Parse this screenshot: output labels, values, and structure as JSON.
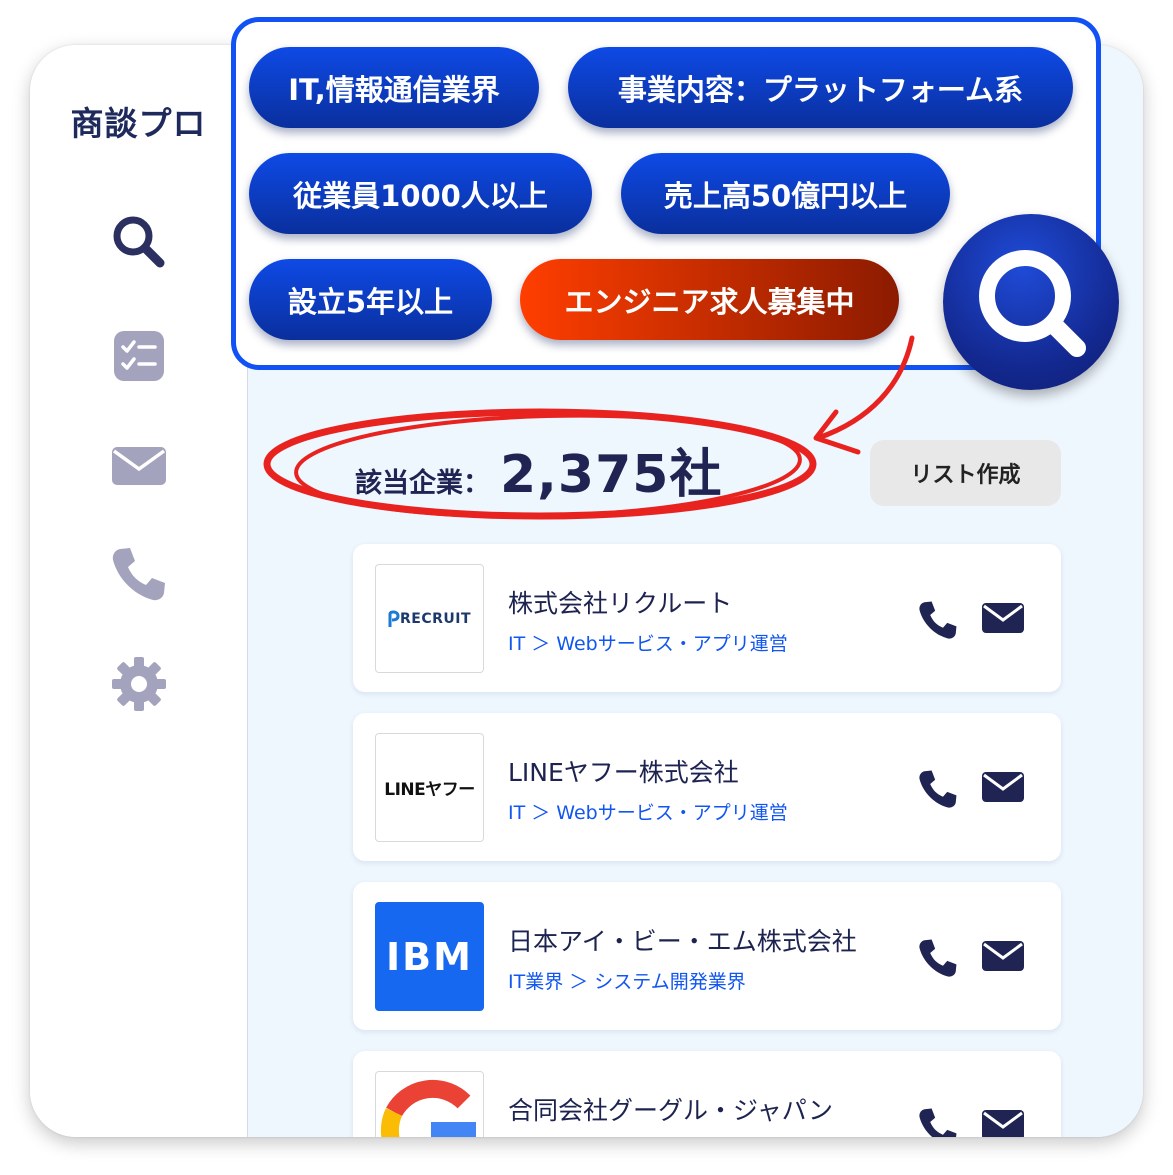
{
  "app": {
    "brand": "商談プロ"
  },
  "sidebar": {
    "items": [
      {
        "icon": "search-icon"
      },
      {
        "icon": "checklist-icon"
      },
      {
        "icon": "mail-icon"
      },
      {
        "icon": "phone-icon"
      },
      {
        "icon": "gear-icon"
      }
    ]
  },
  "filters": {
    "chips": [
      {
        "label": "IT,情報通信業界"
      },
      {
        "label": "事業内容：プラットフォーム系"
      },
      {
        "label": "従業員1000人以上"
      },
      {
        "label": "売上高50億円以上"
      },
      {
        "label": "設立5年以上"
      },
      {
        "label": "エンジニア求人募集中",
        "highlight": true
      }
    ]
  },
  "results": {
    "count_label": "該当企業：",
    "count_value": "2,375社",
    "list_button": "リスト作成"
  },
  "companies": [
    {
      "logo_text": "RECRUIT",
      "name": "株式会社リクルート",
      "category": "IT ＞ Webサービス・アプリ運営"
    },
    {
      "logo_text": "LINEヤフー",
      "name": "LINEヤフー株式会社",
      "category": "IT ＞ Webサービス・アプリ運営"
    },
    {
      "logo_text": "IBM",
      "name": "日本アイ・ビー・エム株式会社",
      "category": "IT業界 ＞ システム開発業界"
    },
    {
      "logo_text": "",
      "name": "合同会社グーグル・ジャパン",
      "category": ""
    }
  ],
  "colors": {
    "accent": "#1252f5",
    "navy": "#1f2452",
    "highlight_chip": "#ff3e00",
    "annotation": "#e8231f",
    "link": "#1156f0"
  }
}
